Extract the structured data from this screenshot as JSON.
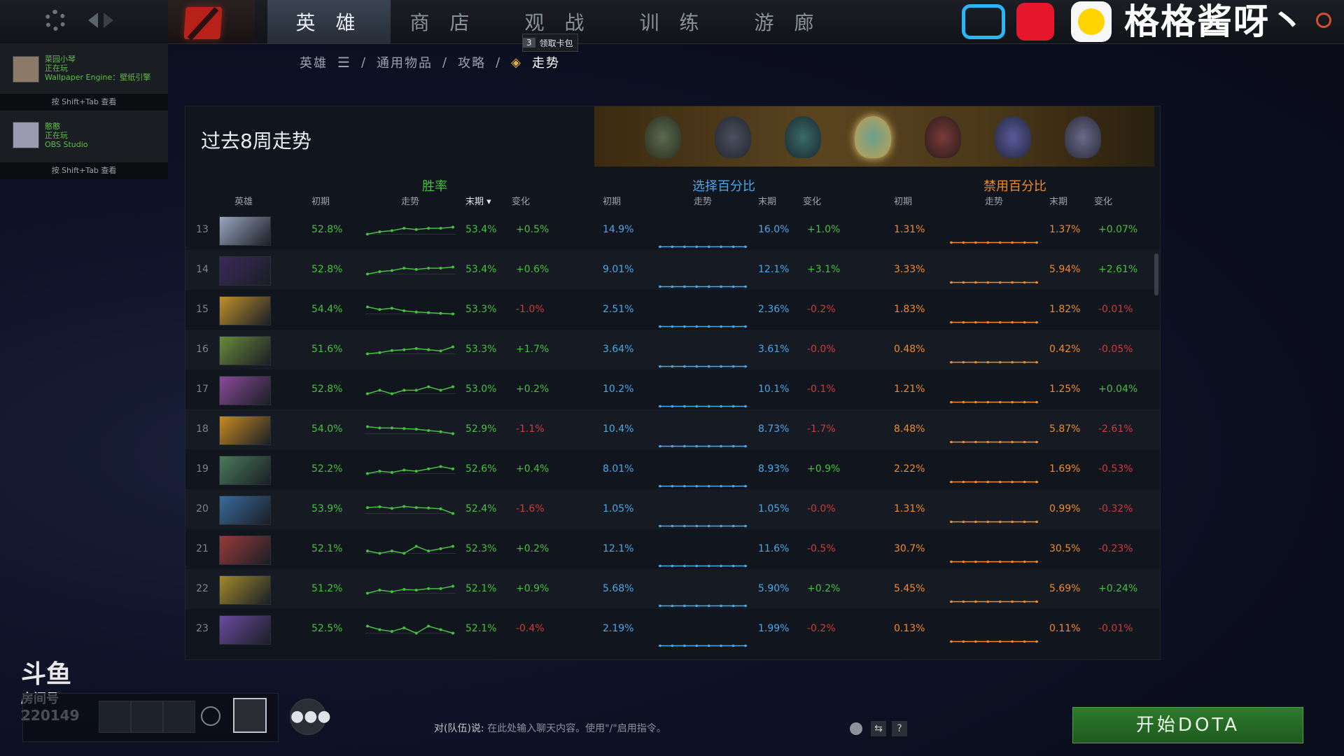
{
  "nav": {
    "tabs": [
      "英 雄",
      "商 店",
      "观 战",
      "训 练",
      "游 廊"
    ],
    "active_tab": 0,
    "badge_count": "3",
    "badge_label": "领取卡包"
  },
  "breadcrumb": [
    "英雄",
    "通用物品",
    "攻略",
    "走势"
  ],
  "streamer_name": "格格酱呀丶",
  "friends": [
    {
      "name": "菜园小琴",
      "status": "正在玩",
      "game": "Wallpaper Engine：壁纸引擎",
      "hint": "按 Shift+Tab 查看"
    },
    {
      "name": "憨憨",
      "status": "正在玩",
      "game": "OBS Studio",
      "hint": "按 Shift+Tab 查看"
    }
  ],
  "panel": {
    "title": "过去8周走势",
    "groups": {
      "winrate": "胜率",
      "pick": "选择百分比",
      "ban": "禁用百分比"
    },
    "columns": {
      "hero": "英雄",
      "start": "初期",
      "trend": "走势",
      "end": "末期",
      "change": "变化"
    }
  },
  "colors": {
    "green": "#46c040",
    "blue": "#4aa8e8",
    "orange": "#f08a2a",
    "red": "#d03a3a"
  },
  "rows": [
    {
      "rank": "13",
      "wr_start": "52.8%",
      "wr_end": "53.4%",
      "wr_change": "+0.5%",
      "pk_start": "14.9%",
      "pk_end": "16.0%",
      "pk_change": "+1.0%",
      "bn_start": "1.31%",
      "bn_end": "1.37%",
      "bn_change": "+0.07%",
      "hero_color": "#9aa6c0",
      "wr_trend": [
        52.8,
        53.0,
        53.1,
        53.3,
        53.2,
        53.3,
        53.3,
        53.4
      ]
    },
    {
      "rank": "14",
      "wr_start": "52.8%",
      "wr_end": "53.4%",
      "wr_change": "+0.6%",
      "pk_start": "9.01%",
      "pk_end": "12.1%",
      "pk_change": "+3.1%",
      "bn_start": "3.33%",
      "bn_end": "5.94%",
      "bn_change": "+2.61%",
      "hero_color": "#3a2a5a",
      "wr_trend": [
        52.8,
        53.0,
        53.1,
        53.3,
        53.2,
        53.3,
        53.3,
        53.4
      ]
    },
    {
      "rank": "15",
      "wr_start": "54.4%",
      "wr_end": "53.3%",
      "wr_change": "-1.0%",
      "pk_start": "2.51%",
      "pk_end": "2.36%",
      "pk_change": "-0.2%",
      "bn_start": "1.83%",
      "bn_end": "1.82%",
      "bn_change": "-0.01%",
      "hero_color": "#c0902a",
      "wr_trend": [
        54.4,
        54.0,
        54.2,
        53.8,
        53.6,
        53.5,
        53.4,
        53.3
      ]
    },
    {
      "rank": "16",
      "wr_start": "51.6%",
      "wr_end": "53.3%",
      "wr_change": "+1.7%",
      "pk_start": "3.64%",
      "pk_end": "3.61%",
      "pk_change": "-0.0%",
      "bn_start": "0.48%",
      "bn_end": "0.42%",
      "bn_change": "-0.05%",
      "hero_color": "#6a8a3a",
      "wr_trend": [
        51.6,
        51.9,
        52.4,
        52.6,
        52.9,
        52.6,
        52.3,
        53.3
      ]
    },
    {
      "rank": "17",
      "wr_start": "52.8%",
      "wr_end": "53.0%",
      "wr_change": "+0.2%",
      "pk_start": "10.2%",
      "pk_end": "10.1%",
      "pk_change": "-0.1%",
      "bn_start": "1.21%",
      "bn_end": "1.25%",
      "bn_change": "+0.04%",
      "hero_color": "#8a4a9a",
      "wr_trend": [
        52.8,
        52.9,
        52.8,
        52.9,
        52.9,
        53.0,
        52.9,
        53.0
      ]
    },
    {
      "rank": "18",
      "wr_start": "54.0%",
      "wr_end": "52.9%",
      "wr_change": "-1.1%",
      "pk_start": "10.4%",
      "pk_end": "8.73%",
      "pk_change": "-1.7%",
      "bn_start": "8.48%",
      "bn_end": "5.87%",
      "bn_change": "-2.61%",
      "hero_color": "#c88a20",
      "wr_trend": [
        54.0,
        53.8,
        53.8,
        53.7,
        53.6,
        53.4,
        53.2,
        52.9
      ]
    },
    {
      "rank": "19",
      "wr_start": "52.2%",
      "wr_end": "52.6%",
      "wr_change": "+0.4%",
      "pk_start": "8.01%",
      "pk_end": "8.93%",
      "pk_change": "+0.9%",
      "bn_start": "2.22%",
      "bn_end": "1.69%",
      "bn_change": "-0.53%",
      "hero_color": "#4a7a5a",
      "wr_trend": [
        52.2,
        52.4,
        52.3,
        52.5,
        52.4,
        52.6,
        52.8,
        52.6
      ]
    },
    {
      "rank": "20",
      "wr_start": "53.9%",
      "wr_end": "52.4%",
      "wr_change": "-1.6%",
      "pk_start": "1.05%",
      "pk_end": "1.05%",
      "pk_change": "-0.0%",
      "bn_start": "1.31%",
      "bn_end": "0.99%",
      "bn_change": "-0.32%",
      "hero_color": "#3a6a9a",
      "wr_trend": [
        53.9,
        54.1,
        53.7,
        54.2,
        53.9,
        53.8,
        53.6,
        52.4
      ]
    },
    {
      "rank": "21",
      "wr_start": "52.1%",
      "wr_end": "52.3%",
      "wr_change": "+0.2%",
      "pk_start": "12.1%",
      "pk_end": "11.6%",
      "pk_change": "-0.5%",
      "bn_start": "30.7%",
      "bn_end": "30.5%",
      "bn_change": "-0.23%",
      "hero_color": "#9a3a3a",
      "wr_trend": [
        52.1,
        52.0,
        52.1,
        52.0,
        52.3,
        52.1,
        52.2,
        52.3
      ]
    },
    {
      "rank": "22",
      "wr_start": "51.2%",
      "wr_end": "52.1%",
      "wr_change": "+0.9%",
      "pk_start": "5.68%",
      "pk_end": "5.90%",
      "pk_change": "+0.2%",
      "bn_start": "5.45%",
      "bn_end": "5.69%",
      "bn_change": "+0.24%",
      "hero_color": "#a08a2a",
      "wr_trend": [
        51.2,
        51.6,
        51.4,
        51.7,
        51.6,
        51.8,
        51.8,
        52.1
      ]
    },
    {
      "rank": "23",
      "wr_start": "52.5%",
      "wr_end": "52.1%",
      "wr_change": "-0.4%",
      "pk_start": "2.19%",
      "pk_end": "1.99%",
      "pk_change": "-0.2%",
      "bn_start": "0.13%",
      "bn_end": "0.11%",
      "bn_change": "-0.01%",
      "hero_color": "#6a4aa0",
      "wr_trend": [
        52.5,
        52.3,
        52.2,
        52.4,
        52.1,
        52.5,
        52.3,
        52.1
      ]
    }
  ],
  "chat": {
    "label": "对(队伍)说:",
    "placeholder": "在此处输入聊天内容。使用\"/\"启用指令。"
  },
  "start_button": "开始DOTA",
  "watermark": {
    "brand": "斗鱼",
    "room_label": "房间号",
    "room": "220149"
  }
}
